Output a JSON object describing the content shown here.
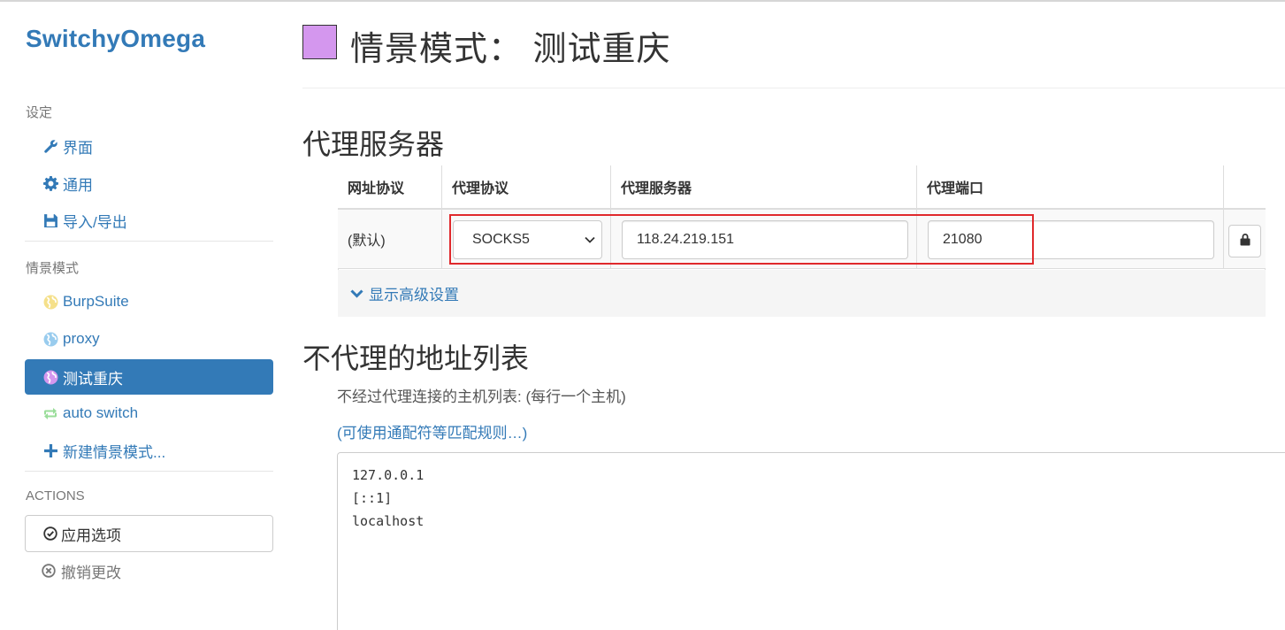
{
  "sidebar": {
    "brand": "SwitchyOmega",
    "settings_header": "设定",
    "settings_items": [
      {
        "label": "界面",
        "icon": "wrench-icon"
      },
      {
        "label": "通用",
        "icon": "gear-icon"
      },
      {
        "label": "导入/导出",
        "icon": "floppy-disk-icon"
      }
    ],
    "profiles_header": "情景模式",
    "profiles": [
      {
        "label": "BurpSuite",
        "icon": "globe-icon",
        "color": "#f5e08a"
      },
      {
        "label": "proxy",
        "icon": "globe-icon",
        "color": "#99ccee"
      },
      {
        "label": "测试重庆",
        "icon": "globe-icon",
        "color": "#d497ee",
        "active": true
      },
      {
        "label": "auto switch",
        "icon": "switch-arrows-icon",
        "color": "#99dd99"
      },
      {
        "label": "新建情景模式...",
        "icon": "plus-icon"
      }
    ],
    "actions_header": "ACTIONS",
    "apply_label": "应用选项",
    "discard_label": "撤销更改"
  },
  "main": {
    "title": "情景模式： 测试重庆",
    "profile_color": "#d497ee",
    "proxy_section_title": "代理服务器",
    "table_headers": [
      "网址协议",
      "代理协议",
      "代理服务器",
      "代理端口"
    ],
    "row": {
      "scheme": "(默认)",
      "protocol": "SOCKS5",
      "server": "118.24.219.151",
      "port": "21080"
    },
    "advanced_label": "显示高级设置",
    "bypass_section_title": "不代理的地址列表",
    "bypass_help": "不经过代理连接的主机列表: (每行一个主机)",
    "wildcard_link": "(可使用通配符等匹配规则…)",
    "bypass_list": "127.0.0.1\n[::1]\nlocalhost"
  },
  "colors": {
    "accent": "#337ab7",
    "highlight_border": "#e0292c"
  }
}
